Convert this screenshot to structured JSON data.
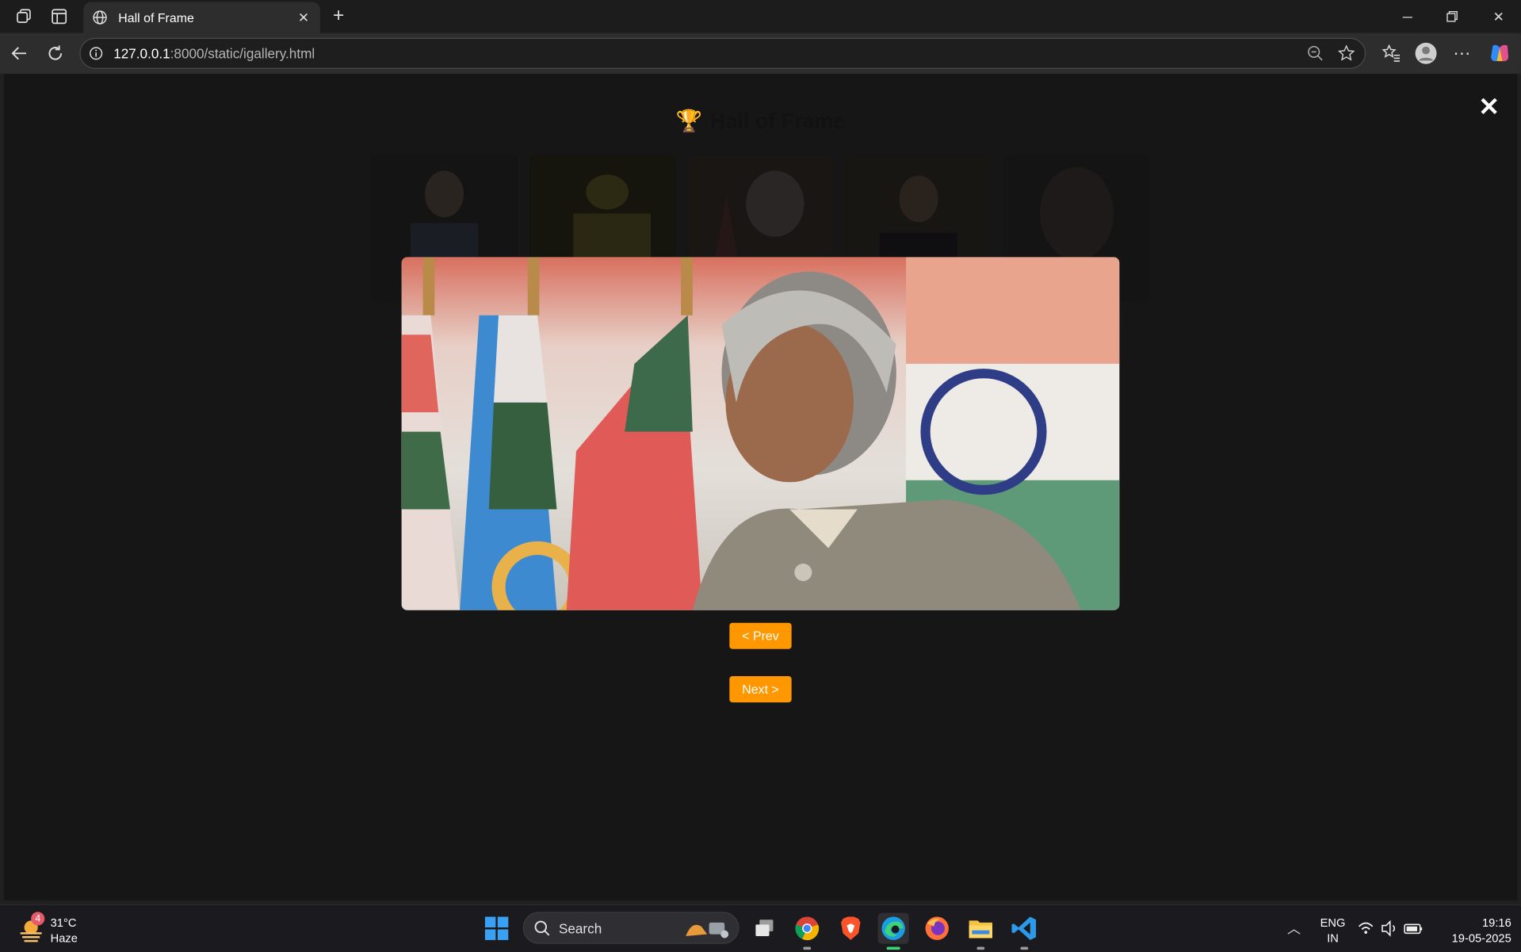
{
  "browser": {
    "tab_title": "Hall of Frame",
    "url_host": "127.0.0.1",
    "url_rest": ":8000/static/igallery.html"
  },
  "page": {
    "heading": "Hall of Frame",
    "thumbnails": [
      "thumb-1",
      "thumb-2",
      "thumb-3",
      "thumb-4",
      "thumb-5"
    ],
    "prev_label": "< Prev",
    "next_label": "Next >",
    "close_label": "✕"
  },
  "taskbar": {
    "weather_temp": "31°C",
    "weather_cond": "Haze",
    "weather_badge": "4",
    "search_label": "Search",
    "lang_1": "ENG",
    "lang_2": "IN",
    "time": "19:16",
    "date": "19-05-2025"
  },
  "colors": {
    "accent": "#ff9800",
    "page_bg": "#161616",
    "chrome_bg": "#2d2d2d"
  }
}
